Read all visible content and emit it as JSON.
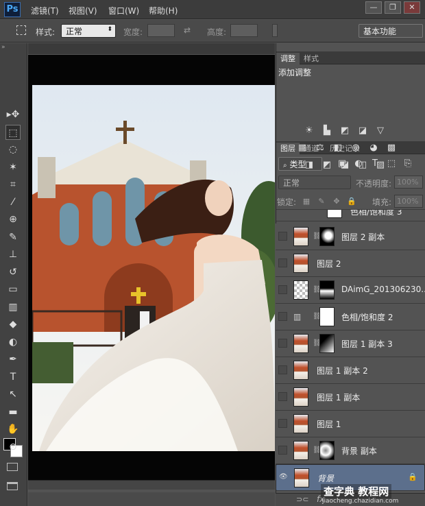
{
  "app": {
    "logo": "Ps"
  },
  "menus": [
    "滤镜(T)",
    "视图(V)",
    "窗口(W)",
    "帮助(H)"
  ],
  "window_controls": {
    "minimize": "—",
    "restore": "❐",
    "close": "✕"
  },
  "options": {
    "style_label": "样式:",
    "style_value": "正常",
    "width_label": "宽度:",
    "height_label": "高度:",
    "swap_icon": "⇄",
    "workspace": "基本功能"
  },
  "toolbar": {
    "collapse": "»",
    "tools": [
      "move-icon",
      "marquee-icon",
      "lasso-icon",
      "magic-wand-icon",
      "crop-icon",
      "eyedropper-icon",
      "healing-icon",
      "brush-icon",
      "stamp-icon",
      "history-brush-icon",
      "eraser-icon",
      "gradient-icon",
      "blur-icon",
      "dodge-icon",
      "pen-icon",
      "type-icon",
      "path-select-icon",
      "shape-icon",
      "hand-icon",
      "zoom-icon"
    ],
    "tool_glyphs": [
      "▸✥",
      "⬚",
      "◌",
      "✶",
      "⌗",
      "⁄",
      "⊕",
      "✎",
      "⊥",
      "↺",
      "▭",
      "▥",
      "◆",
      "◐",
      "✒",
      "T",
      "↖",
      "▬",
      "✋",
      "⊙"
    ],
    "fg_color": "#000000",
    "bg_color": "#ffffff"
  },
  "adjust_panel": {
    "tabs": [
      "调整",
      "样式"
    ],
    "title": "添加调整",
    "row1": [
      "☀",
      "▙",
      "◩",
      "◪",
      "▽"
    ],
    "row2": [
      "▦",
      "⚖",
      "◧",
      "◎",
      "◕",
      "▩"
    ],
    "row3": [
      "◨",
      "◩",
      "◪",
      "◫",
      "▨"
    ]
  },
  "layers_panel": {
    "tabs": [
      "图层",
      "通道",
      "历史记录"
    ],
    "filter_value": "类型",
    "filter_icons": [
      "▣",
      "◐",
      "T",
      "⬚",
      "⎘"
    ],
    "blend_mode": "正常",
    "opacity_label": "不透明度:",
    "opacity_value": "100%",
    "lock_label": "锁定:",
    "lock_icons": [
      "▦",
      "✎",
      "✥",
      "🔒"
    ],
    "fill_label": "填充:",
    "fill_value": "100%",
    "partial_layer": "色相/饱和度 3",
    "layers": [
      {
        "name": "图层 2 副本",
        "thumb": "photo",
        "mask": "dark"
      },
      {
        "name": "图层 2",
        "thumb": "photo",
        "mask": ""
      },
      {
        "name": "DAimG_201306230...",
        "thumb": "transparent",
        "mask": "black-white"
      },
      {
        "name": "色相/饱和度 2",
        "thumb": "adjust",
        "mask": "white"
      },
      {
        "name": "图层 1 副本 3",
        "thumb": "photo",
        "mask": "gradient"
      },
      {
        "name": "图层 1 副本 2",
        "thumb": "photo",
        "mask": ""
      },
      {
        "name": "图层 1 副本",
        "thumb": "photo",
        "mask": ""
      },
      {
        "name": "图层 1",
        "thumb": "photo",
        "mask": ""
      },
      {
        "name": "背景 副本",
        "thumb": "photo",
        "mask": "blotchy"
      },
      {
        "name": "背景",
        "thumb": "photo",
        "mask": "",
        "selected": true
      }
    ],
    "footer_icons": [
      "⊃⊂",
      "fx"
    ]
  },
  "watermark": {
    "main": "查字典 教程网",
    "sub": "jiaocheng.chazidian.com"
  }
}
